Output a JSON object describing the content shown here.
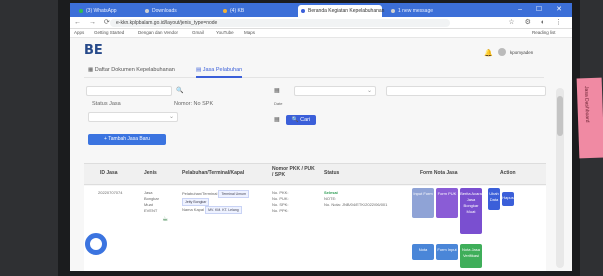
{
  "browser": {
    "tabs": [
      {
        "label": "(3) WhatsApp",
        "dot": "#2fbf50"
      },
      {
        "label": "Downloads",
        "dot": "#d0d0d0"
      },
      {
        "label": "(4) KB",
        "dot": "#f2b234"
      },
      {
        "label": "Beranda Kegiatan Kepelabuhanan",
        "dot": "#ffffff",
        "active": true
      },
      {
        "label": "1 new message",
        "dot": "#d0d0d0"
      }
    ],
    "url": "e-kkn.kplpbalam.go.id/layout/jenis_type=node",
    "bookmarks": [
      "Apps",
      "Getting Started",
      "Dengan dan Vendor",
      "Gmail",
      "YouTube",
      "Maps"
    ],
    "reading_list": "Reading list",
    "nav_icons": "← → ⟳",
    "ext_icons": "☆ ⚙ ◐ ⋮",
    "window_buttons": "–  ☐  ✕"
  },
  "app": {
    "logo": "BE",
    "user": "kpomyaden",
    "notif_icon": "🔔",
    "tabs": [
      {
        "label": "Daftar Dokumen Kepelabuhanan",
        "icon": "▦"
      },
      {
        "label": "Jasa Pelabuhan",
        "icon": "▤",
        "active": true
      }
    ],
    "filters": {
      "search_icon": "🔍",
      "calendar_icon": "▦",
      "jasa_label": "Status Jasa",
      "spk_label": "Nomor: No SPK",
      "date_label": "Date",
      "search_button": "Cari",
      "add_button": "+ Tambah Jasa Baru"
    },
    "table": {
      "headers": [
        "ID Jasa",
        "Jenis",
        "Pelabuhan/Terminal/Kapal",
        "Nomor PKK / PUK / SPK",
        "Status",
        "Form Nota Jasa",
        "Action"
      ],
      "row": {
        "id": "20220707074",
        "jenis": [
          "Jasa",
          "Bongkar",
          "Muat",
          "EVENT"
        ],
        "pelabuhan": [
          "Pelabuhan/Terminal",
          "Jetty Bongkar",
          "Nama Kapal"
        ],
        "pelabuhan_tags": [
          "Terminal Umum",
          "MV. KM. KT. Lelang"
        ],
        "nomor": [
          "No. PKK:",
          "No. PUK:",
          "No. SPK:",
          "No. PPK:"
        ],
        "status": [
          "Selesai",
          "NOTE:",
          "No. Nota: JNB/04/ETK/2022/06/001"
        ],
        "forms": [
          {
            "label": "Input Form",
            "color": "#8fa3d6"
          },
          {
            "label": "Form PUK",
            "color": "#8a5cd6"
          },
          {
            "label": "Berita Acara Jasa Bongkar Muat",
            "color": "#7a4fd0"
          },
          {
            "label": "Nota",
            "color": "#4a86d8"
          },
          {
            "label": "Form Input",
            "color": "#4a86d8"
          },
          {
            "label": "Nota Jasa Verifikasi",
            "color": "#3fae5a"
          }
        ],
        "actions": [
          {
            "label": "Ubah Data",
            "color": "#3b5fd9"
          },
          {
            "label": "Hapus",
            "color": "#3b5fd9"
          }
        ]
      }
    }
  },
  "sticky_note": "Jasa Dashboard",
  "floating_icon": "☕"
}
